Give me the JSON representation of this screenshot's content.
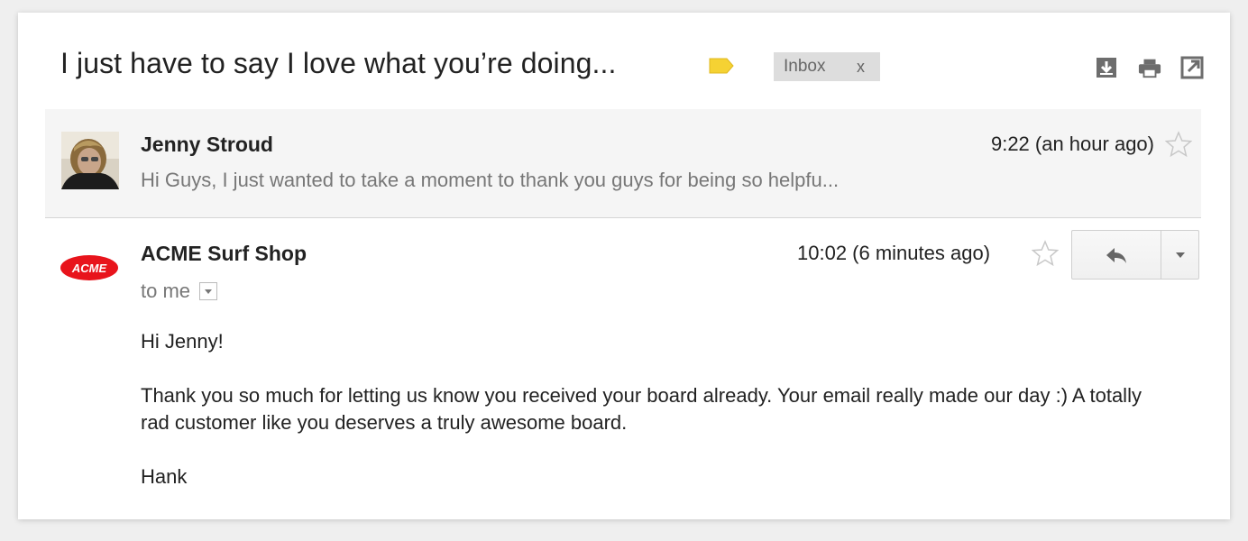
{
  "thread": {
    "subject": "I just have to say I love what you’re doing...",
    "label_color": "#f5d233",
    "inbox_chip": {
      "label": "Inbox",
      "remove": "x"
    },
    "toolbar_icons": [
      "download-icon",
      "print-icon",
      "new-window-icon"
    ]
  },
  "messages": [
    {
      "sender": "Jenny Stroud",
      "time": "9:22 (an hour ago)",
      "snippet": "Hi Guys, I just wanted to take a moment to thank you guys for being so helpfu...",
      "starred": false,
      "state": "collapsed"
    },
    {
      "sender": "ACME Surf Shop",
      "logo_text": "ACME",
      "time": "10:02 (6 minutes ago)",
      "recipient": "to me",
      "starred": false,
      "state": "expanded",
      "body": {
        "greeting": "Hi Jenny!",
        "paragraph": "Thank you so much for letting us know you received your board already. Your email really made our day :) A totally rad customer like you deserves a truly awesome board.",
        "signature": "Hank"
      }
    }
  ],
  "colors": {
    "acme_red": "#e8141c",
    "collapsed_bg": "#f5f5f5",
    "chip_bg": "#dddddd"
  }
}
